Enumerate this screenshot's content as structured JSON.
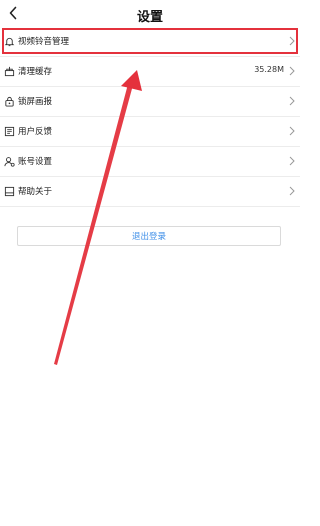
{
  "header": {
    "title": "设置",
    "back_icon": "chevron-left-icon"
  },
  "menu": {
    "items": [
      {
        "label": "视频铃音管理",
        "icon": "bell-icon",
        "value": "",
        "highlighted": true
      },
      {
        "label": "清理缓存",
        "icon": "sweep-icon",
        "value": "35.28M",
        "highlighted": false
      },
      {
        "label": "锁屏画报",
        "icon": "lock-icon",
        "value": "",
        "highlighted": false
      },
      {
        "label": "用户反馈",
        "icon": "feedback-icon",
        "value": "",
        "highlighted": false
      },
      {
        "label": "账号设置",
        "icon": "account-icon",
        "value": "",
        "highlighted": false
      },
      {
        "label": "帮助关于",
        "icon": "help-icon",
        "value": "",
        "highlighted": false
      }
    ]
  },
  "logout": {
    "label": "退出登录"
  },
  "colors": {
    "accent": "#3f8fe8",
    "annotation": "#e4313c"
  }
}
